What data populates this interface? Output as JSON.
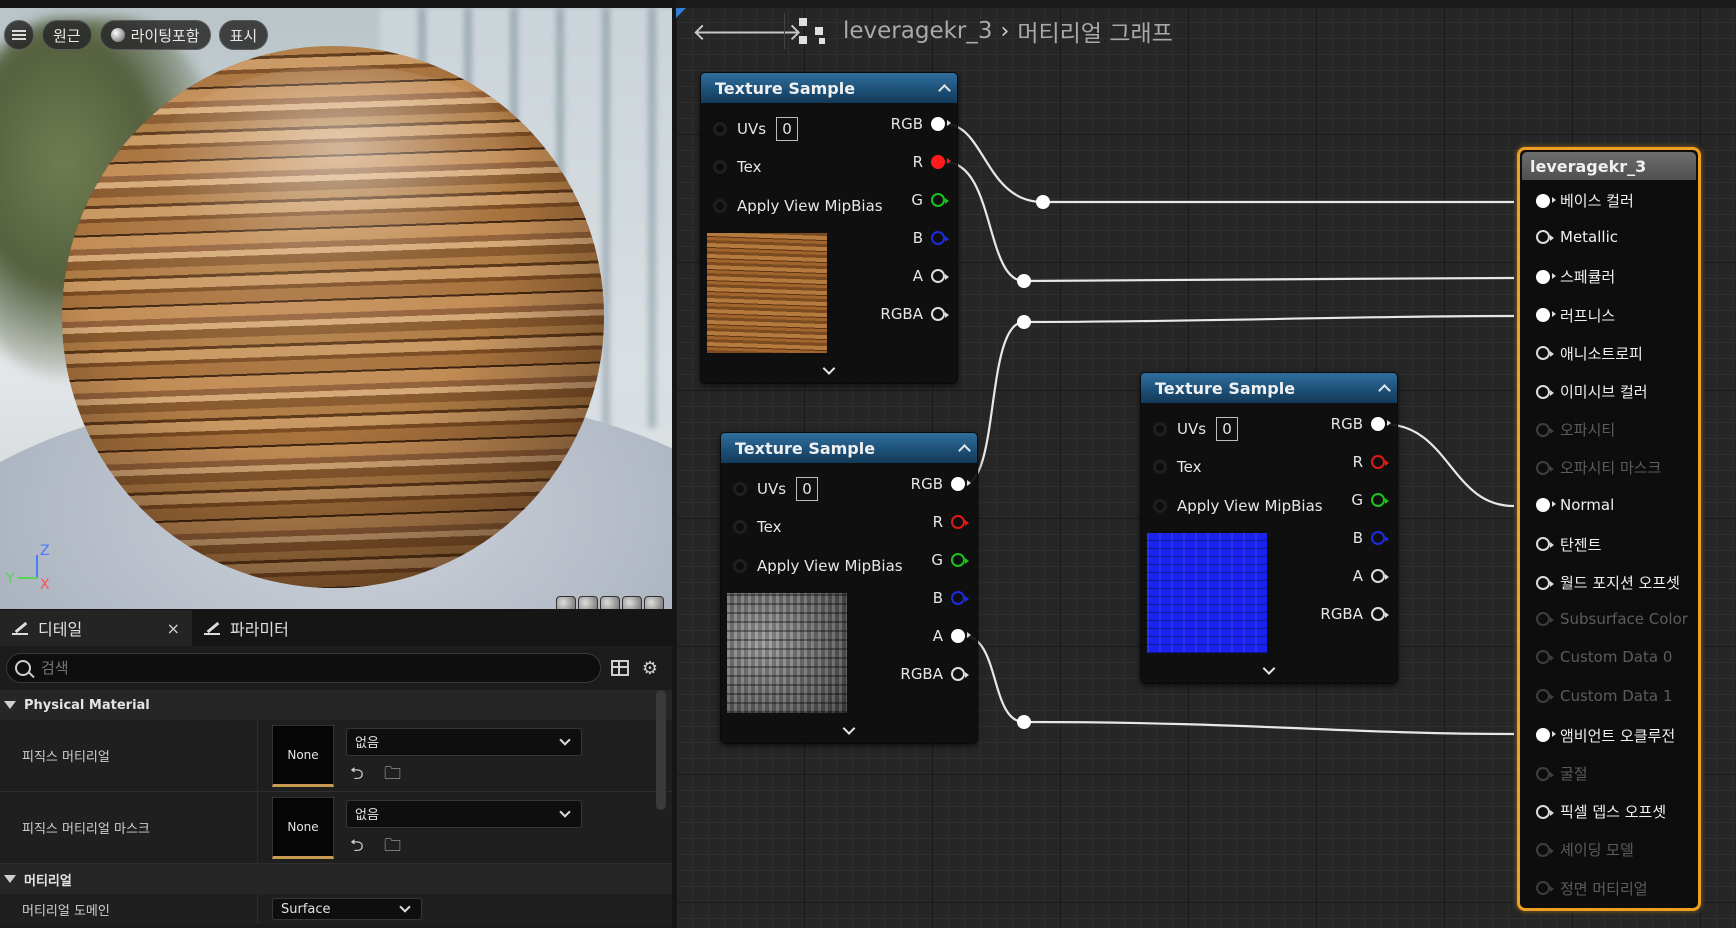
{
  "viewport": {
    "toolbar": {
      "perspective": "원근",
      "lighting": "라이팅포함",
      "show": "표시"
    },
    "axes": {
      "z": "Z",
      "y": "Y",
      "x": "X"
    }
  },
  "details": {
    "tabs": [
      {
        "label": "디테일",
        "close": "×"
      },
      {
        "label": "파라미터"
      }
    ],
    "search_placeholder": "검색",
    "sections": {
      "physical": "Physical Material",
      "material": "머티리얼"
    },
    "properties": [
      {
        "label": "피직스 머티리얼",
        "thumb": "None",
        "value": "없음"
      },
      {
        "label": "피직스 머티리얼 마스크",
        "thumb": "None",
        "value": "없음"
      }
    ],
    "material_domain": {
      "label": "머티리얼 도메인",
      "value": "Surface"
    }
  },
  "graph": {
    "breadcrumb": {
      "asset": "leveragekr_3",
      "separator": "›",
      "page": "머티리얼 그래프"
    },
    "texture_node": {
      "title": "Texture Sample",
      "inputs": {
        "uvs": "UVs",
        "uvs_value": "0",
        "tex": "Tex",
        "mip": "Apply View MipBias"
      },
      "outputs": {
        "rgb": "RGB",
        "r": "R",
        "g": "G",
        "b": "B",
        "a": "A",
        "rgba": "RGBA"
      }
    },
    "result_node": {
      "title": "leveragekr_3",
      "inputs": [
        {
          "label": "베이스 컬러",
          "state": "connected"
        },
        {
          "label": "Metallic",
          "state": "open"
        },
        {
          "label": "스페큘러",
          "state": "connected"
        },
        {
          "label": "러프니스",
          "state": "connected"
        },
        {
          "label": "애니소트로피",
          "state": "open"
        },
        {
          "label": "이미시브 컬러",
          "state": "open"
        },
        {
          "label": "오파시티",
          "state": "disabled"
        },
        {
          "label": "오파시티 마스크",
          "state": "disabled"
        },
        {
          "label": "Normal",
          "state": "connected"
        },
        {
          "label": "탄젠트",
          "state": "open"
        },
        {
          "label": "월드 포지션 오프셋",
          "state": "open"
        },
        {
          "label": "Subsurface Color",
          "state": "disabled"
        },
        {
          "label": "Custom Data 0",
          "state": "disabled"
        },
        {
          "label": "Custom Data 1",
          "state": "disabled"
        },
        {
          "label": "앰비언트 오클루전",
          "state": "connected"
        },
        {
          "label": "굴절",
          "state": "disabled"
        },
        {
          "label": "픽셀 뎁스 오프셋",
          "state": "open"
        },
        {
          "label": "셰이딩 모델",
          "state": "disabled"
        },
        {
          "label": "정면 머티리얼",
          "state": "disabled"
        }
      ]
    },
    "colors": {
      "selection": "#f0a020",
      "header_texture": "#1c4e74",
      "wire": "#e8e8e8"
    }
  }
}
